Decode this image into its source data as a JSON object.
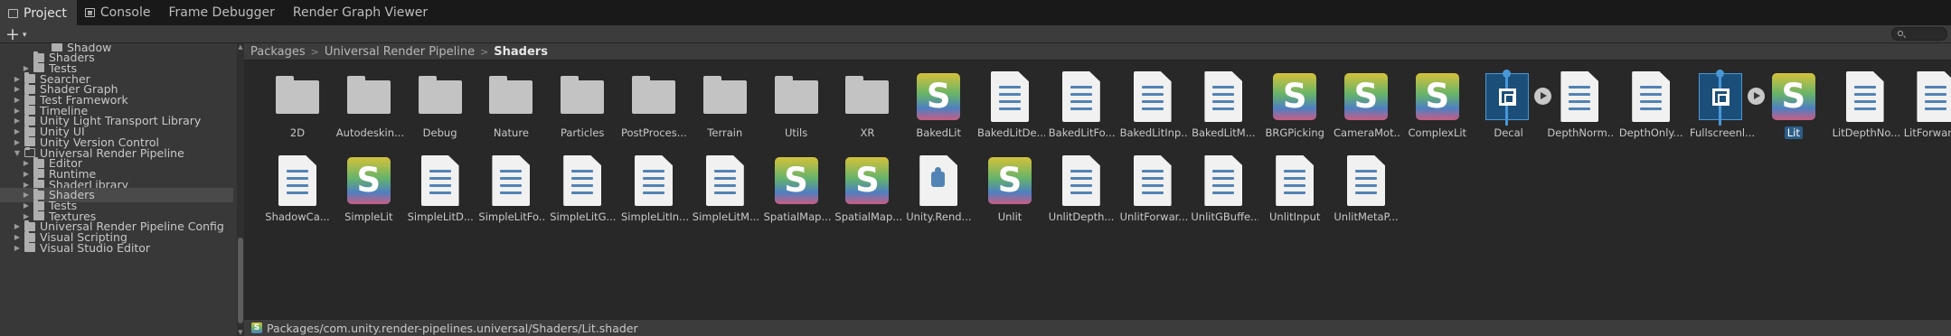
{
  "tabs": [
    {
      "label": "Project",
      "icon": "folder-icon",
      "active": true
    },
    {
      "label": "Console",
      "icon": "console-icon",
      "active": false
    },
    {
      "label": "Frame Debugger",
      "icon": "",
      "active": false
    },
    {
      "label": "Render Graph Viewer",
      "icon": "",
      "active": false
    }
  ],
  "toolbar": {
    "add_label": "+",
    "add_caret": "▾"
  },
  "tree": [
    {
      "label": "Shadow",
      "level": 4,
      "arrow": "",
      "open": false,
      "selected": false
    },
    {
      "label": "Shaders",
      "level": 2,
      "arrow": "",
      "open": false,
      "selected": false
    },
    {
      "label": "Tests",
      "level": 2,
      "arrow": "▶",
      "open": false,
      "selected": false
    },
    {
      "label": "Searcher",
      "level": 1,
      "arrow": "▶",
      "open": false,
      "selected": false
    },
    {
      "label": "Shader Graph",
      "level": 1,
      "arrow": "▶",
      "open": false,
      "selected": false
    },
    {
      "label": "Test Framework",
      "level": 1,
      "arrow": "▶",
      "open": false,
      "selected": false
    },
    {
      "label": "Timeline",
      "level": 1,
      "arrow": "▶",
      "open": false,
      "selected": false
    },
    {
      "label": "Unity Light Transport Library",
      "level": 1,
      "arrow": "▶",
      "open": false,
      "selected": false
    },
    {
      "label": "Unity UI",
      "level": 1,
      "arrow": "▶",
      "open": false,
      "selected": false
    },
    {
      "label": "Unity Version Control",
      "level": 1,
      "arrow": "▶",
      "open": false,
      "selected": false
    },
    {
      "label": "Universal Render Pipeline",
      "level": 1,
      "arrow": "▼",
      "open": true,
      "selected": false
    },
    {
      "label": "Editor",
      "level": 2,
      "arrow": "▶",
      "open": false,
      "selected": false
    },
    {
      "label": "Runtime",
      "level": 2,
      "arrow": "▶",
      "open": false,
      "selected": false
    },
    {
      "label": "ShaderLibrary",
      "level": 2,
      "arrow": "▶",
      "open": false,
      "selected": false
    },
    {
      "label": "Shaders",
      "level": 2,
      "arrow": "▶",
      "open": false,
      "selected": true
    },
    {
      "label": "Tests",
      "level": 2,
      "arrow": "▶",
      "open": false,
      "selected": false
    },
    {
      "label": "Textures",
      "level": 2,
      "arrow": "▶",
      "open": false,
      "selected": false
    },
    {
      "label": "Universal Render Pipeline Config",
      "level": 1,
      "arrow": "▶",
      "open": false,
      "selected": false
    },
    {
      "label": "Visual Scripting",
      "level": 1,
      "arrow": "▶",
      "open": false,
      "selected": false
    },
    {
      "label": "Visual Studio Editor",
      "level": 1,
      "arrow": "▶",
      "open": false,
      "selected": false
    }
  ],
  "breadcrumb": {
    "items": [
      "Packages",
      "Universal Render Pipeline",
      "Shaders"
    ],
    "separator": ">"
  },
  "assets": [
    {
      "label": "2D",
      "kind": "folder"
    },
    {
      "label": "Autodeskin...",
      "kind": "folder"
    },
    {
      "label": "Debug",
      "kind": "folder"
    },
    {
      "label": "Nature",
      "kind": "folder"
    },
    {
      "label": "Particles",
      "kind": "folder"
    },
    {
      "label": "PostProces...",
      "kind": "folder"
    },
    {
      "label": "Terrain",
      "kind": "folder"
    },
    {
      "label": "Utils",
      "kind": "folder"
    },
    {
      "label": "XR",
      "kind": "folder"
    },
    {
      "label": "BakedLit",
      "kind": "shadergraph"
    },
    {
      "label": "BakedLitDe...",
      "kind": "doc"
    },
    {
      "label": "BakedLitFo...",
      "kind": "doc"
    },
    {
      "label": "BakedLitInp...",
      "kind": "doc"
    },
    {
      "label": "BakedLitM...",
      "kind": "doc"
    },
    {
      "label": "BRGPicking",
      "kind": "shadergraph"
    },
    {
      "label": "CameraMot...",
      "kind": "shadergraph"
    },
    {
      "label": "ComplexLit",
      "kind": "shadergraph"
    },
    {
      "label": "Decal",
      "kind": "variant"
    },
    {
      "label": "DepthNorm...",
      "kind": "doc"
    },
    {
      "label": "DepthOnly...",
      "kind": "doc"
    },
    {
      "label": "Fullscreenl...",
      "kind": "variant"
    },
    {
      "label": "Lit",
      "kind": "shadergraph",
      "selected": true
    },
    {
      "label": "LitDepthNo...",
      "kind": "doc"
    },
    {
      "label": "LitForward...",
      "kind": "doc"
    },
    {
      "label": "ShadowCa...",
      "kind": "doc"
    },
    {
      "label": "SimpleLit",
      "kind": "shadergraph"
    },
    {
      "label": "SimpleLitD...",
      "kind": "doc"
    },
    {
      "label": "SimpleLitFo...",
      "kind": "doc"
    },
    {
      "label": "SimpleLitG...",
      "kind": "doc"
    },
    {
      "label": "SimpleLitIn...",
      "kind": "doc"
    },
    {
      "label": "SimpleLitM...",
      "kind": "doc"
    },
    {
      "label": "SpatialMap...",
      "kind": "shadergraph"
    },
    {
      "label": "SpatialMap...",
      "kind": "shadergraph"
    },
    {
      "label": "Unity.Rend...",
      "kind": "package"
    },
    {
      "label": "Unlit",
      "kind": "shadergraph"
    },
    {
      "label": "UnlitDepth...",
      "kind": "doc"
    },
    {
      "label": "UnlitForwar...",
      "kind": "doc"
    },
    {
      "label": "UnlitGBuffe...",
      "kind": "doc"
    },
    {
      "label": "UnlitInput",
      "kind": "doc"
    },
    {
      "label": "UnlitMetaP...",
      "kind": "doc"
    }
  ],
  "shader_graph_letter": "S",
  "status": {
    "path": "Packages/com.unity.render-pipelines.universal/Shaders/Lit.shader",
    "icon_letter": "S"
  }
}
